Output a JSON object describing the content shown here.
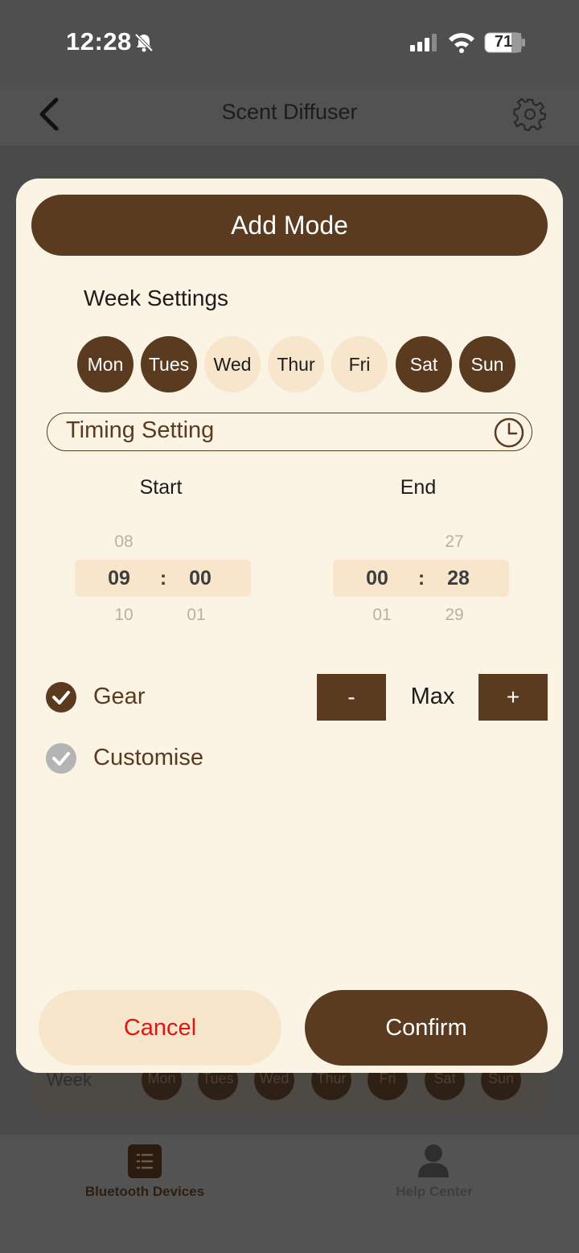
{
  "status_bar": {
    "time": "12:28",
    "battery": "71"
  },
  "header": {
    "title": "Scent Diffuser"
  },
  "background": {
    "week_label": "Week",
    "days": [
      "Mon",
      "Tues",
      "Wed",
      "Thur",
      "Fri",
      "Sat",
      "Sun"
    ]
  },
  "tabbar": {
    "tab1": "Bluetooth Devices",
    "tab2": "Help Center"
  },
  "modal": {
    "title": "Add Mode",
    "week_settings_label": "Week Settings",
    "days": [
      {
        "label": "Mon",
        "selected": true
      },
      {
        "label": "Tues",
        "selected": true
      },
      {
        "label": "Wed",
        "selected": false
      },
      {
        "label": "Thur",
        "selected": false
      },
      {
        "label": "Fri",
        "selected": false
      },
      {
        "label": "Sat",
        "selected": true
      },
      {
        "label": "Sun",
        "selected": true
      }
    ],
    "timing_label": "Timing Setting",
    "start": {
      "label": "Start",
      "hour_prev": "08",
      "hour": "09",
      "hour_next": "10",
      "minute_prev": "",
      "minute": "00",
      "minute_next": "01",
      "separator": ":"
    },
    "end": {
      "label": "End",
      "hour_prev": "",
      "hour": "00",
      "hour_next": "01",
      "minute_prev": "27",
      "minute": "28",
      "minute_next": "29",
      "separator": ":"
    },
    "gear": {
      "label": "Gear",
      "checked": true,
      "minus": "-",
      "value": "Max",
      "plus": "+"
    },
    "customise": {
      "label": "Customise",
      "checked": false
    },
    "cancel": "Cancel",
    "confirm": "Confirm"
  },
  "colors": {
    "brand": "#5a3b20",
    "cream": "#fbf3e4",
    "chip": "#f8e6cc",
    "cancel_text": "#e11414"
  }
}
